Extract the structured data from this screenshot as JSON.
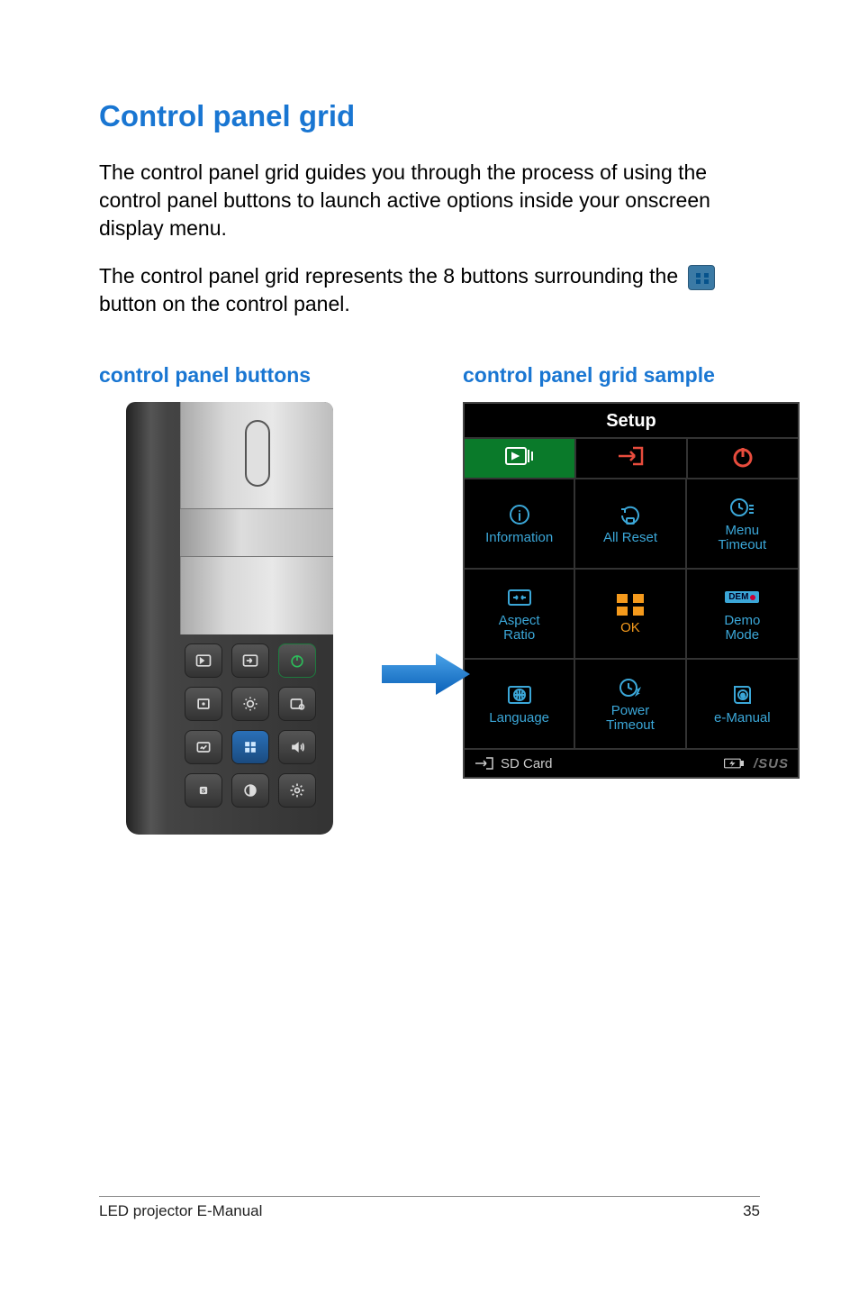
{
  "title": "Control panel grid",
  "para1": "The control panel grid guides you through the process of using the control panel buttons to launch active options inside your onscreen display menu.",
  "para2a": "The control panel grid represents the 8 buttons surrounding the ",
  "para2b": " button on the control panel.",
  "left_heading": "control panel buttons",
  "right_heading": "control panel grid sample",
  "osd": {
    "title": "Setup",
    "cells": {
      "info": "Information",
      "allreset": "All Reset",
      "menutimeout_l1": "Menu",
      "menutimeout_l2": "Timeout",
      "aspect_l1": "Aspect",
      "aspect_l2": "Ratio",
      "ok": "OK",
      "demo_badge": "DEM",
      "demo_l1": "Demo",
      "demo_l2": "Mode",
      "language": "Language",
      "power_l1": "Power",
      "power_l2": "Timeout",
      "emanual": "e-Manual"
    },
    "footer_source": "SD Card",
    "footer_brand": "/SUS"
  },
  "footer_doc": "LED projector E-Manual",
  "footer_page": "35"
}
